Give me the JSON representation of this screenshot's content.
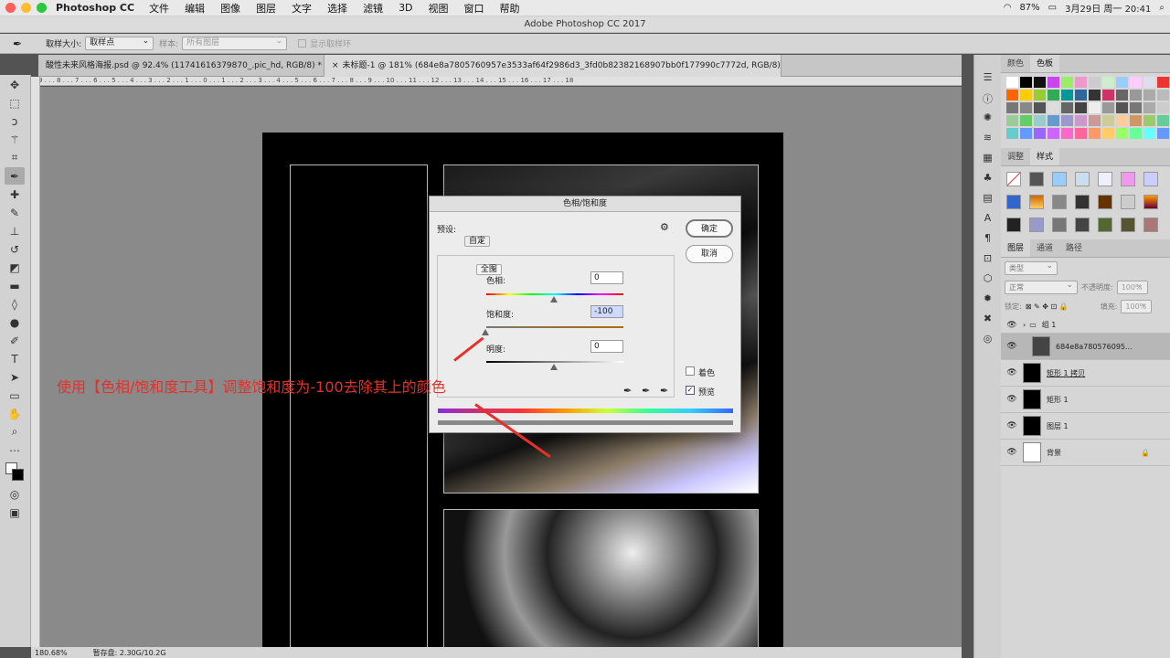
{
  "menubar": {
    "app_name": "Photoshop CC",
    "items": [
      "文件",
      "编辑",
      "图像",
      "图层",
      "文字",
      "选择",
      "滤镜",
      "3D",
      "视图",
      "窗口",
      "帮助"
    ],
    "battery": "87%",
    "datetime": "3月29日 周一  20:41"
  },
  "window_title": "Adobe Photoshop CC 2017",
  "options_bar": {
    "sample_size_label": "取样大小:",
    "sample_size_value": "取样点",
    "sample_label": "样本:",
    "sample_value": "所有图层",
    "show_ring_label": "显示取样环"
  },
  "tabs": [
    {
      "label": "酸性未来风格海报.psd @ 92.4% (11741616379870_.pic_hd, RGB/8) *"
    },
    {
      "label": "未标题-1 @ 181% (684e8a7805760957e3533af64f2986d3_3fd0b82382168907bb0f177990c7772d, RGB/8) *"
    }
  ],
  "ruler_marks": "9 . . . 8 . . . 7 . . . 6 . . . 5 . . . 4 . . . 3 . . . 2 . . . 1 . . . 0 . . . 1 . . . 2 . . . 3 . . . 4 . . . 5 . . . 6 . . . 7 . . . 8 . . . 9 . . . 10 . . . 11 . . . 12 . . . 13 . . . 14 . . . 15 . . . 16 . . . 17 . . . 18",
  "status": {
    "zoom": "180.68%",
    "scratch": "暂存盘: 2.30G/10.2G"
  },
  "color_panel": {
    "tabs": [
      "颜色",
      "色板"
    ]
  },
  "adjust_panel": {
    "tabs": [
      "调整",
      "样式"
    ]
  },
  "layers_panel": {
    "tabs": [
      "图层",
      "通道",
      "路径"
    ],
    "kind_filter": "类型",
    "blend_mode": "正常",
    "opacity_label": "不透明度:",
    "opacity_value": "100%",
    "lock_label": "锁定:",
    "fill_label": "填充:",
    "fill_value": "100%",
    "layers": [
      {
        "name": "组 1"
      },
      {
        "name": "684e8a780576095..."
      },
      {
        "name": "矩形 1 拷贝"
      },
      {
        "name": "矩形 1"
      },
      {
        "name": "图层 1"
      },
      {
        "name": "背景"
      }
    ]
  },
  "dialog": {
    "title": "色相/饱和度",
    "preset_label": "预设:",
    "preset_value": "自定",
    "ok_button": "确定",
    "cancel_button": "取消",
    "channel": "全图",
    "hue_label": "色相:",
    "hue_value": "0",
    "saturation_label": "饱和度:",
    "saturation_value": "-100",
    "lightness_label": "明度:",
    "lightness_value": "0",
    "colorize_label": "着色",
    "preview_label": "预览",
    "preview_checked": true,
    "colorize_checked": false
  },
  "caption": "使用【色相/饱和度工具】调整饱和度为-100去除其上的颜色",
  "colors": {
    "accent_red": "#e5302a",
    "canvas_bg": "#8a8a8a"
  }
}
